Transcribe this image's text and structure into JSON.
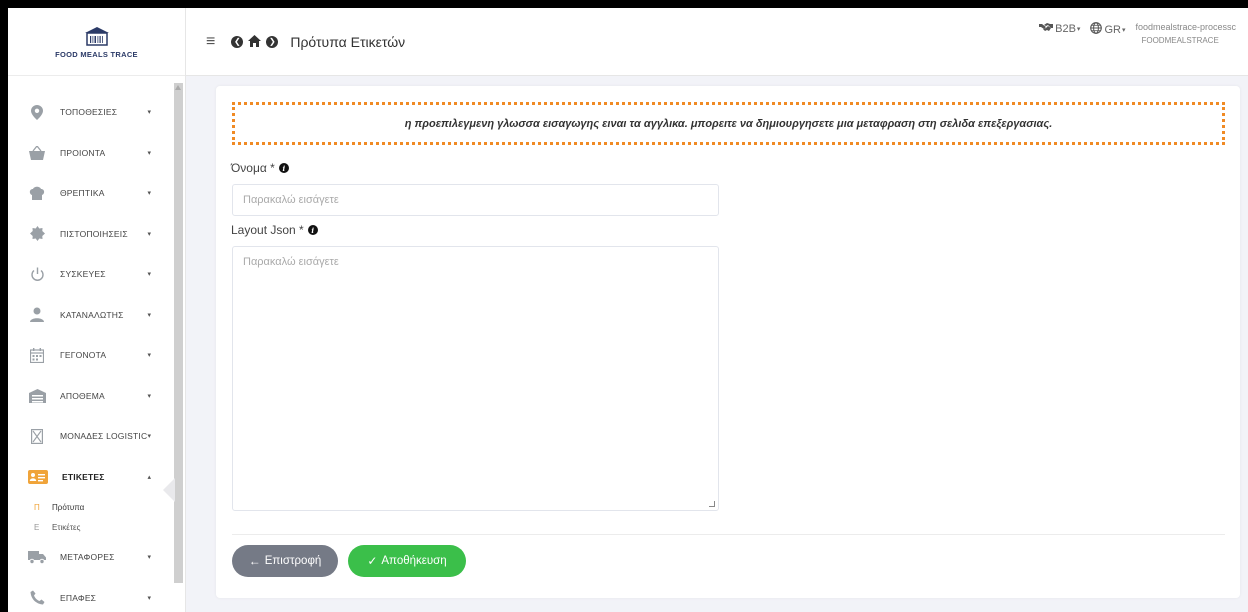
{
  "brand": {
    "logo_text": "FOOD MEALS TRACE"
  },
  "sidebar": {
    "items": [
      {
        "label": "ΤΟΠΟΘΕΣΙΕΣ",
        "icon": "location-pin-icon",
        "glyph": "⬤",
        "caret": "▾"
      },
      {
        "label": "ΠΡΟΙΟΝΤΑ",
        "icon": "basket-icon",
        "glyph": "🧺",
        "caret": "▾"
      },
      {
        "label": "ΘΡΕΠΤΙΚΑ",
        "icon": "chef-hat-icon",
        "glyph": "☁",
        "caret": "▾"
      },
      {
        "label": "ΠΙΣΤΟΠΟΙΗΣΕΙΣ",
        "icon": "certificate-badge-icon",
        "glyph": "✹",
        "caret": "▾"
      },
      {
        "label": "ΣΥΣΚΕΥΕΣ",
        "icon": "power-icon",
        "glyph": "⏻",
        "caret": "▾"
      },
      {
        "label": "ΚΑΤΑΝΑΛΩΤΗΣ",
        "icon": "user-icon",
        "glyph": "👤",
        "caret": "▾"
      },
      {
        "label": "ΓΕΓΟΝΟΤΑ",
        "icon": "calendar-icon",
        "glyph": "▦",
        "caret": "▾"
      },
      {
        "label": "ΑΠΟΘΕΜΑ",
        "icon": "warehouse-icon",
        "glyph": "▤",
        "caret": "▾"
      },
      {
        "label": "ΜΟΝΑΔΕΣ LOGISTIC",
        "icon": "logistics-box-icon",
        "glyph": "⊠",
        "caret": "▾"
      },
      {
        "label": "ΕΤΙΚΕΤΕΣ",
        "icon": "label-card-icon",
        "glyph": "▣≡",
        "caret": "▴"
      }
    ],
    "sub_items": [
      {
        "letter": "П",
        "label": "Πρότυπα"
      },
      {
        "letter": "Е",
        "label": "Ετικέτες"
      }
    ],
    "items_after": [
      {
        "label": "ΜΕΤΑΦΟΡΕΣ",
        "icon": "truck-icon",
        "glyph": "🚚",
        "caret": "▾"
      },
      {
        "label": "ΕΠΑΦΕΣ",
        "icon": "phone-icon",
        "glyph": "✆",
        "caret": "▾"
      }
    ]
  },
  "header": {
    "menu_glyph": "≡",
    "back_glyph": "❮",
    "home_glyph": "⌂",
    "forward_glyph": "❯",
    "title": "Πρότυπα Ετικετών",
    "b2b_label": "B2B",
    "b2b_glyph": "🤝",
    "lang_label": "GR",
    "lang_glyph": "🌐",
    "caret": "▾",
    "username": "foodmealstrace-processc",
    "org": "FOODMEALSTRACE"
  },
  "form": {
    "notice": "η προεπιλεγμενη γλωσσα εισαγωγης ειναι τα αγγλικα. μπορειτε να δημιουργησετε μια μεταφραση στη σελιδα επεξεργασιας.",
    "name_label": "Όνομα *",
    "name_placeholder": "Παρακαλώ εισάγετε",
    "layout_label": "Layout Json *",
    "layout_placeholder": "Παρακαλώ εισάγετε",
    "info_glyph": "i",
    "back_button": "Επιστροφή",
    "back_glyph": "←",
    "save_button": "Αποθήκευση",
    "save_glyph": "✓"
  },
  "colors": {
    "accent_orange": "#f08a24",
    "save_green": "#3bbf4a",
    "back_gray": "#757a86",
    "active_badge": "#f0a43a"
  }
}
